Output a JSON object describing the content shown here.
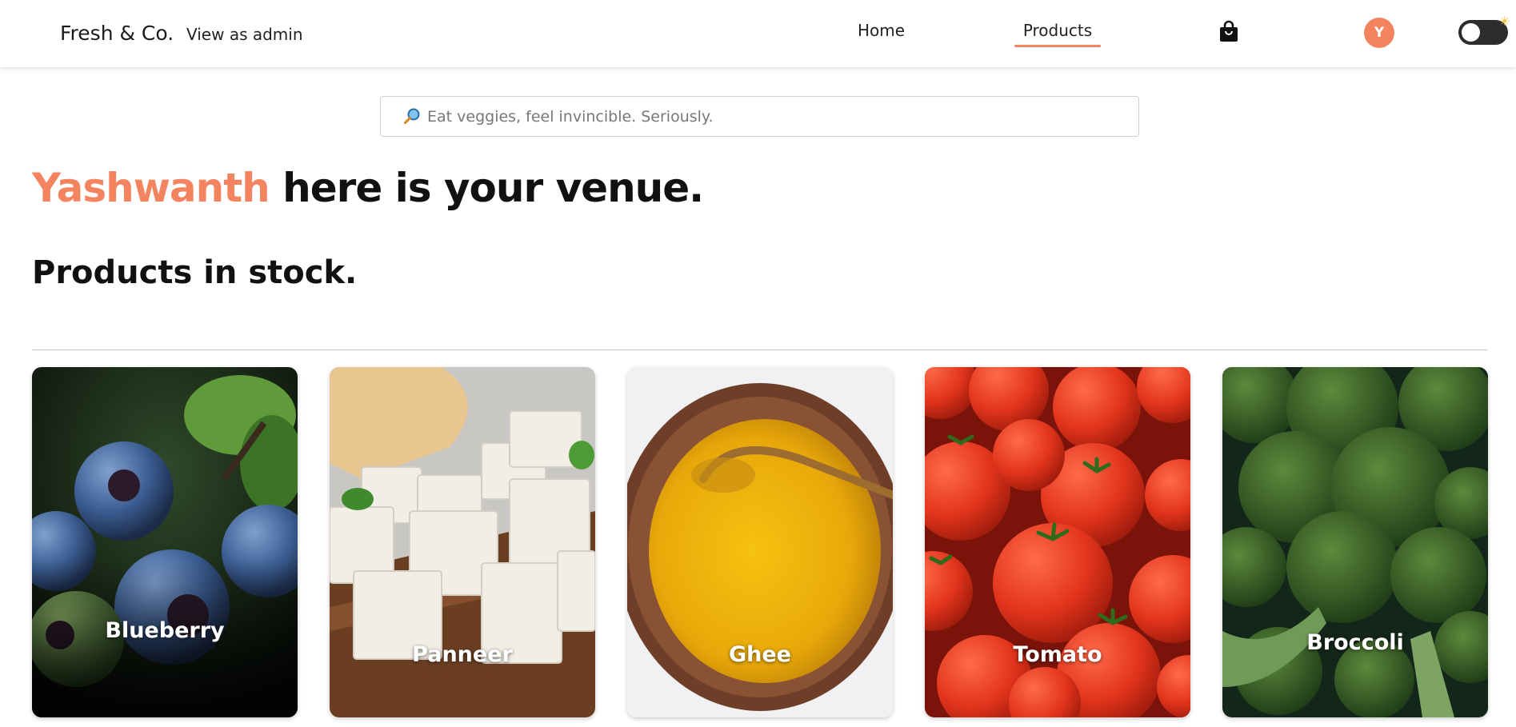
{
  "header": {
    "brand": "Fresh & Co.",
    "admin_link": "View as admin",
    "nav": [
      {
        "label": "Home",
        "active": false
      },
      {
        "label": "Products",
        "active": true
      }
    ],
    "cart_icon": "shopping-bag-icon",
    "avatar_initial": "Y",
    "theme_toggle_icon": "sun-icon"
  },
  "search": {
    "placeholder": "Eat veggies, feel invincible. Seriously.",
    "value": "",
    "icon": "magnifier-icon"
  },
  "greeting": {
    "name": "Yashwanth",
    "rest": "here is your venue."
  },
  "section_title": "Products in stock.",
  "products": [
    {
      "name": "Blueberry"
    },
    {
      "name": "Panneer"
    },
    {
      "name": "Ghee"
    },
    {
      "name": "Tomato"
    },
    {
      "name": "Broccoli"
    }
  ],
  "colors": {
    "accent": "#f4845f",
    "text": "#111111",
    "divider": "#c6c6c6",
    "toggle": "#2d2d2d"
  }
}
